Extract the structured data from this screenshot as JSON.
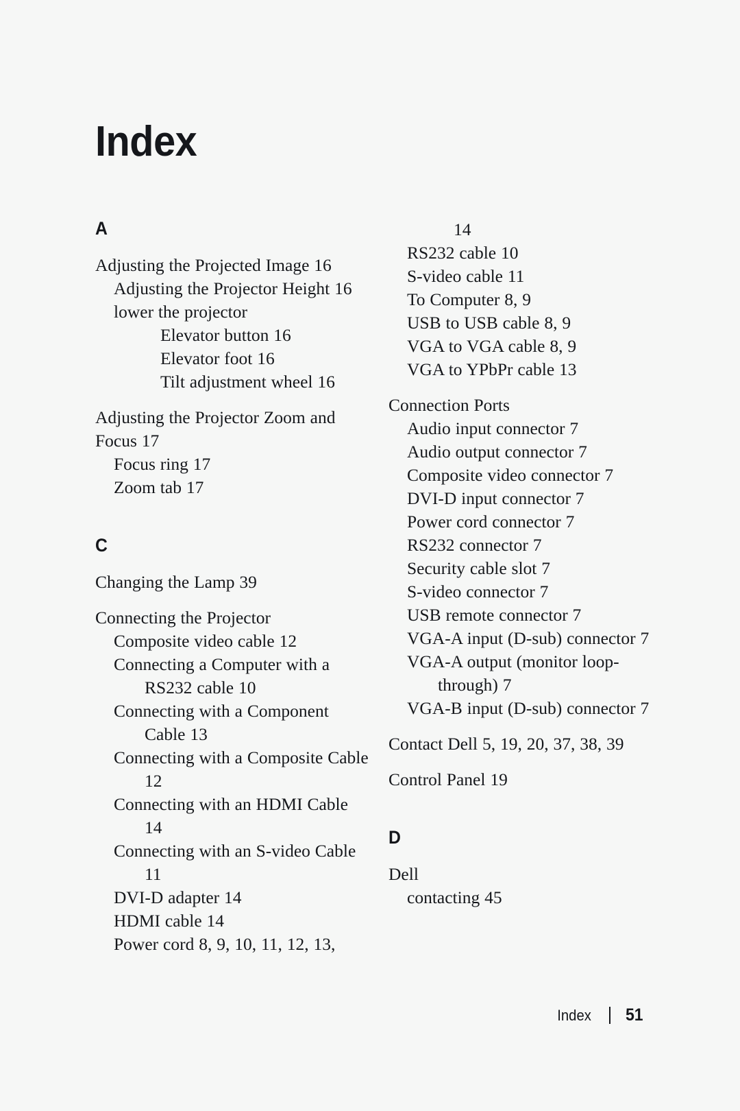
{
  "page": {
    "title": "Index",
    "background_color": "#f6f7f6",
    "text_color": "#16181c"
  },
  "footer": {
    "label": "Index",
    "separator": "|",
    "page_number": "51"
  },
  "columns": {
    "left": {
      "sections": [
        {
          "letter": "A",
          "entries": [
            {
              "level": 0,
              "text": "Adjusting the Projected Image 16"
            },
            {
              "level": 1,
              "text": "Adjusting the Projector Height 16"
            },
            {
              "level": 1,
              "text": "lower the projector"
            },
            {
              "level": 2,
              "text": "Elevator button 16"
            },
            {
              "level": 2,
              "text": "Elevator foot 16"
            },
            {
              "level": 2,
              "text": "Tilt adjustment wheel 16"
            },
            {
              "level": 0,
              "text": "Adjusting the Projector Zoom and Focus 17",
              "gap": true
            },
            {
              "level": 1,
              "text": "Focus ring 17"
            },
            {
              "level": 1,
              "text": "Zoom tab 17"
            }
          ]
        },
        {
          "letter": "C",
          "entries": [
            {
              "level": 0,
              "text": "Changing the Lamp 39"
            },
            {
              "level": 0,
              "text": "Connecting the Projector",
              "gap": true
            },
            {
              "level": 1,
              "text": "Composite video cable 12"
            },
            {
              "level": 1,
              "text": "Connecting a Computer with a RS232 cable 10"
            },
            {
              "level": 1,
              "text": "Connecting with a Component Cable 13"
            },
            {
              "level": 1,
              "text": "Connecting with a Composite Cable 12"
            },
            {
              "level": 1,
              "text": "Connecting with an HDMI Cable 14"
            },
            {
              "level": 1,
              "text": "Connecting with an S-video Cable 11"
            },
            {
              "level": 1,
              "text": "DVI-D adapter 14"
            },
            {
              "level": 1,
              "text": "HDMI cable 14"
            },
            {
              "level": 1,
              "text": "Power cord 8, 9, 10, 11, 12, 13,"
            }
          ]
        }
      ]
    },
    "right": {
      "sections": [
        {
          "letter": "",
          "entries": [
            {
              "level": -1,
              "text": "14"
            },
            {
              "level": 1,
              "text": "RS232 cable 10"
            },
            {
              "level": 1,
              "text": "S-video cable 11"
            },
            {
              "level": 1,
              "text": "To Computer 8, 9"
            },
            {
              "level": 1,
              "text": "USB to USB cable 8, 9"
            },
            {
              "level": 1,
              "text": "VGA to VGA cable 8, 9"
            },
            {
              "level": 1,
              "text": "VGA to YPbPr cable 13"
            },
            {
              "level": 0,
              "text": "Connection Ports",
              "gap": true
            },
            {
              "level": 1,
              "text": "Audio input connector 7"
            },
            {
              "level": 1,
              "text": "Audio output connector 7"
            },
            {
              "level": 1,
              "text": "Composite video connector 7"
            },
            {
              "level": 1,
              "text": "DVI-D input connector 7"
            },
            {
              "level": 1,
              "text": "Power cord connector 7"
            },
            {
              "level": 1,
              "text": "RS232 connector 7"
            },
            {
              "level": 1,
              "text": "Security cable slot 7"
            },
            {
              "level": 1,
              "text": "S-video connector 7"
            },
            {
              "level": 1,
              "text": "USB remote connector 7"
            },
            {
              "level": 1,
              "text": "VGA-A input (D-sub) connector 7"
            },
            {
              "level": 1,
              "text": "VGA-A output (monitor loop-through) 7"
            },
            {
              "level": 1,
              "text": "VGA-B input (D-sub) connector 7"
            },
            {
              "level": 0,
              "text": "Contact Dell 5, 19, 20, 37, 38, 39",
              "gap": true
            },
            {
              "level": 0,
              "text": "Control Panel 19",
              "gap": true
            }
          ]
        },
        {
          "letter": "D",
          "entries": [
            {
              "level": 0,
              "text": "Dell"
            },
            {
              "level": 1,
              "text": "contacting 45"
            }
          ]
        }
      ]
    }
  }
}
